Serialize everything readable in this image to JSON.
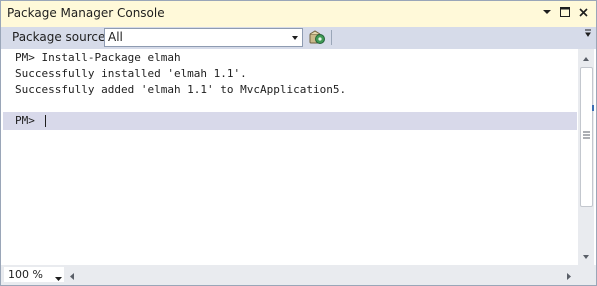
{
  "window": {
    "title": "Package Manager Console"
  },
  "toolbar": {
    "source_label": "Package source:",
    "source_value": "All",
    "settings_icon": "package-settings-icon"
  },
  "console": {
    "lines": [
      "PM> Install-Package elmah",
      "Successfully installed 'elmah 1.1'.",
      "Successfully added 'elmah 1.1' to MvcApplication5."
    ],
    "prompt": "PM>"
  },
  "status": {
    "zoom": "100 %"
  },
  "colors": {
    "titlebar_bg": "#fff9d9",
    "toolbar_bg": "#d6dbe9",
    "prompt_row_bg": "#d8d9ea",
    "scrollbar_bg": "#e9ebef"
  }
}
